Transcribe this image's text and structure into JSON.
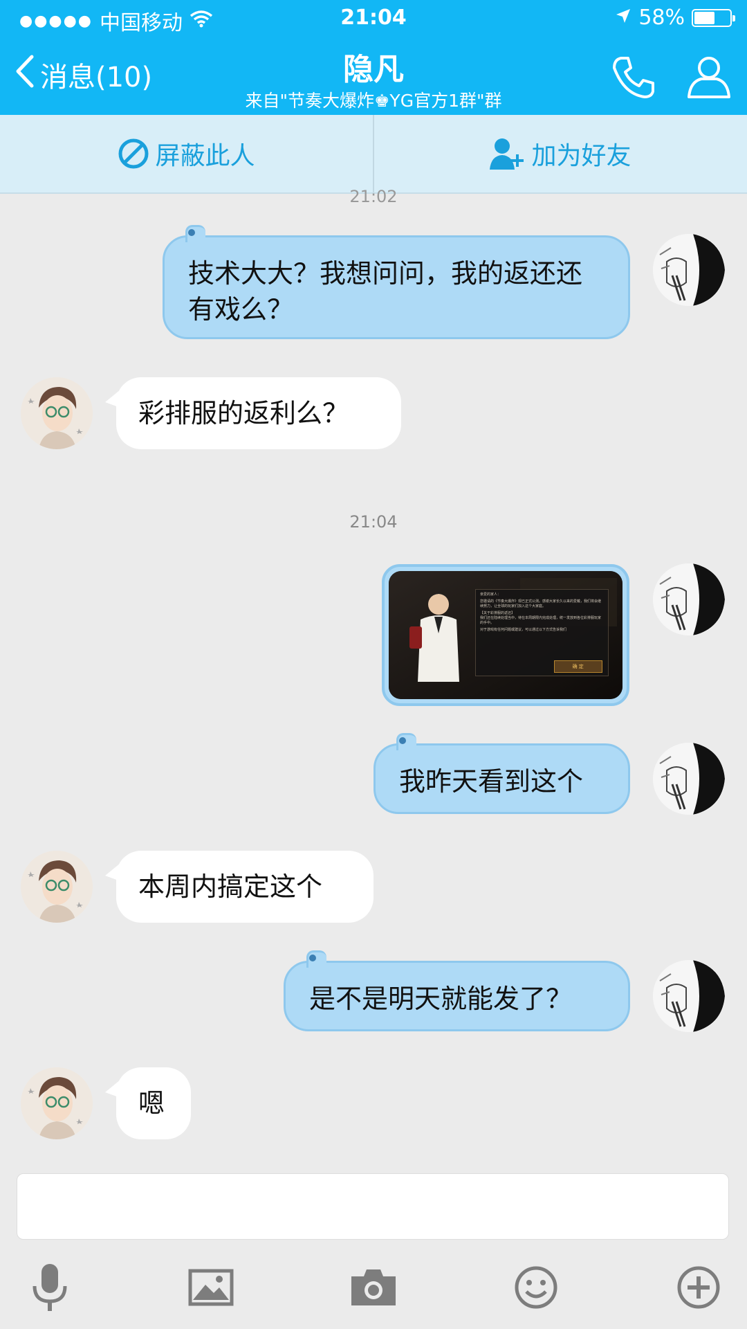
{
  "status_bar": {
    "signal_dots": "●●●●●",
    "carrier": "中国移动",
    "time": "21:04",
    "battery": "58%",
    "battery_level": 0.58
  },
  "nav": {
    "back_label": "消息(10)",
    "title": "隐凡",
    "subtitle": "来自\"节奏大爆炸♚YG官方1群\"群"
  },
  "actions": {
    "block": "屏蔽此人",
    "add_friend": "加为好友"
  },
  "timestamps": [
    "21:02",
    "21:04"
  ],
  "messages": [
    {
      "from": "me",
      "text": "技术大大？我想问问，我的返还还有戏么？"
    },
    {
      "from": "them",
      "text": "彩排服的返利么？"
    },
    {
      "from": "me",
      "type": "image"
    },
    {
      "from": "me",
      "text": "我昨天看到这个"
    },
    {
      "from": "them",
      "text": "本周内搞定这个"
    },
    {
      "from": "me",
      "text": "是不是明天就能发了？"
    },
    {
      "from": "them",
      "text": "嗯"
    }
  ],
  "image_message": {
    "greeting": "亲爱的家人：",
    "body": "您邀请的《节奏大爆炸》现已正式公测。感谢大家长久以来的爱戴，我们将会继续努力，让全球的玩家们加入这个大家庭。",
    "heading": "【关于彩排服的返还】",
    "body2": "我们还在陆续处理当中，待在本周期限内完成处理，统一发放到各位彩排服玩家的手中。",
    "footer": "对于游戏有任何问题或建议，可以通过以下方式告诉我们",
    "button": "确 定"
  },
  "toolbar_icons": [
    "mic-icon",
    "picture-icon",
    "camera-icon",
    "emoji-icon",
    "plus-icon"
  ],
  "colors": {
    "header": "#12b7f5",
    "my_bubble": "#aedaf6",
    "their_bubble": "#ffffff",
    "accent": "#1aa0dc"
  }
}
